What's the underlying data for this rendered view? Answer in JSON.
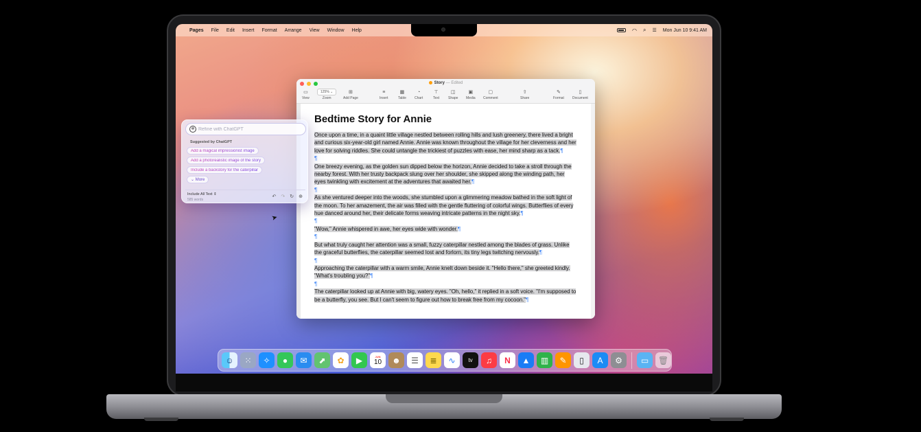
{
  "menubar": {
    "app_name": "Pages",
    "menus": [
      "File",
      "Edit",
      "Insert",
      "Format",
      "Arrange",
      "View",
      "Window",
      "Help"
    ],
    "datetime": "Mon Jun 10  9:41 AM"
  },
  "window": {
    "title": "Story",
    "status": "— Edited",
    "zoom_value": "125%",
    "toolbar": {
      "view": "View",
      "zoom": "Zoom",
      "add_page": "Add Page",
      "insert": "Insert",
      "table": "Table",
      "chart": "Chart",
      "text": "Text",
      "shape": "Shape",
      "media": "Media",
      "comment": "Comment",
      "share": "Share",
      "format": "Format",
      "document": "Document"
    }
  },
  "document": {
    "title": "Bedtime Story for Annie",
    "paragraphs": [
      "Once upon a time, in a quaint little village nestled between rolling hills and lush greenery, there lived a bright and curious six-year-old girl named Annie. Annie was known throughout the village for her cleverness and her love for solving riddles. She could untangle the trickiest of puzzles with ease, her mind sharp as a tack.",
      "One breezy evening, as the golden sun dipped below the horizon, Annie decided to take a stroll through the nearby forest. With her trusty backpack slung over her shoulder, she skipped along the winding path, her eyes twinkling with excitement at the adventures that awaited her.",
      "As she ventured deeper into the woods, she stumbled upon a glimmering meadow bathed in the soft light of the moon. To her amazement, the air was filled with the gentle fluttering of colorful wings. Butterflies of every hue danced around her, their delicate forms weaving intricate patterns in the night sky.",
      "\"Wow,\" Annie whispered in awe, her eyes wide with wonder.",
      "But what truly caught her attention was a small, fuzzy caterpillar nestled among the blades of grass. Unlike the graceful butterflies, the caterpillar seemed lost and forlorn, its tiny legs twitching nervously.",
      "Approaching the caterpillar with a warm smile, Annie knelt down beside it. \"Hello there,\" she greeted kindly. \"What's troubling you?\"",
      "The caterpillar looked up at Annie with big, watery eyes. \"Oh, hello,\" it replied in a soft voice. \"I'm supposed to be a butterfly, you see. But I can't seem to figure out how to break free from my cocoon.\""
    ],
    "pilcrow": "¶"
  },
  "writing_tools": {
    "placeholder": "Refine with ChatGPT",
    "suggested_label": "Suggested by ChatGPT",
    "suggestions": [
      "Add a magical impressionist image",
      "Add a photorealistic image of the story",
      "Include a backstory for the caterpillar"
    ],
    "more_label": "More",
    "include_label": "Include All Text",
    "word_count": "585 words"
  },
  "dock": {
    "calendar_month": "JUN",
    "calendar_day": "10",
    "apps": [
      "finder-icon",
      "launchpad-icon",
      "safari-icon",
      "messages-icon",
      "mail-icon",
      "maps-icon",
      "photos-icon",
      "facetime-icon",
      "calendar-icon",
      "contacts-icon",
      "reminders-icon",
      "notes-icon",
      "freeform-icon",
      "tv-icon",
      "music-icon",
      "news-icon",
      "keynote-icon",
      "numbers-icon",
      "pages-icon",
      "iphone-mirroring-icon",
      "app-store-icon",
      "system-settings-icon",
      "downloads-folder-icon",
      "trash-icon"
    ]
  },
  "colors": {
    "accent": "#2f7bf6",
    "close": "#ff5f57",
    "minimize": "#febc2e",
    "zoom": "#28c840",
    "edited_dot": "#ff9f0a"
  }
}
